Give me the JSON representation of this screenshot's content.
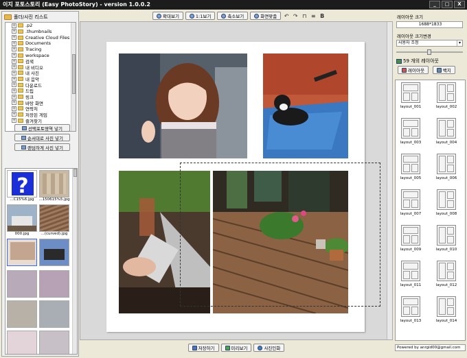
{
  "window": {
    "title": "이지 포토스토리 (Easy PhotoStory) - version 1.0.0.2",
    "controls": [
      "_",
      "□",
      "X"
    ]
  },
  "left": {
    "header": "폴더/사진 리스트",
    "tree": [
      ".p2",
      ".thumbnails",
      "Creative Cloud Files",
      "Documents",
      "Tracing",
      "workspace",
      "검색",
      "내 비디오",
      "내 사진",
      "내 음악",
      "다운로드",
      "드립",
      "링크",
      "바탕 화면",
      "연락처",
      "저장된 게임",
      "즐겨찾기"
    ],
    "buttons": [
      "선택포토영역 넣기",
      "순서대로 사진 넣기",
      "랜덤하게 사진 넣기"
    ],
    "thumbs": [
      {
        "cap": "...C15%6.jpg"
      },
      {
        "cap": "...150615%5.jpg"
      },
      {
        "cap": "000.jpg"
      },
      {
        "cap": "...(curved).jpg"
      },
      {
        "cap": ""
      },
      {
        "cap": ""
      },
      {
        "cap": ""
      },
      {
        "cap": ""
      },
      {
        "cap": ""
      },
      {
        "cap": ""
      },
      {
        "cap": ""
      },
      {
        "cap": ""
      }
    ]
  },
  "toolbar": {
    "buttons": [
      "확대보기",
      "1:1보기",
      "축소보기",
      "화면맞춤"
    ],
    "icons": [
      "↶",
      "↷",
      "⊓",
      "≡",
      "B"
    ]
  },
  "bottom": {
    "buttons": [
      "저장하기",
      "미리보기",
      "사진인화"
    ]
  },
  "right": {
    "layout_size_label": "레이아웃 크기",
    "layout_size_value": "1688*1833",
    "change_label": "레이아웃 크기변경",
    "select_value": "사용자 조정",
    "count_text": "59 개의 레이아웃",
    "btn_layout": "레이아웃",
    "btn_bg": "백지",
    "layouts": [
      "layout_001",
      "layout_002",
      "layout_003",
      "layout_004",
      "layout_005",
      "layout_006",
      "layout_007",
      "layout_008",
      "layout_009",
      "layout_010",
      "layout_011",
      "layout_012",
      "layout_013",
      "layout_014"
    ],
    "footer": "Powered by anrgid00@gmail.com"
  }
}
